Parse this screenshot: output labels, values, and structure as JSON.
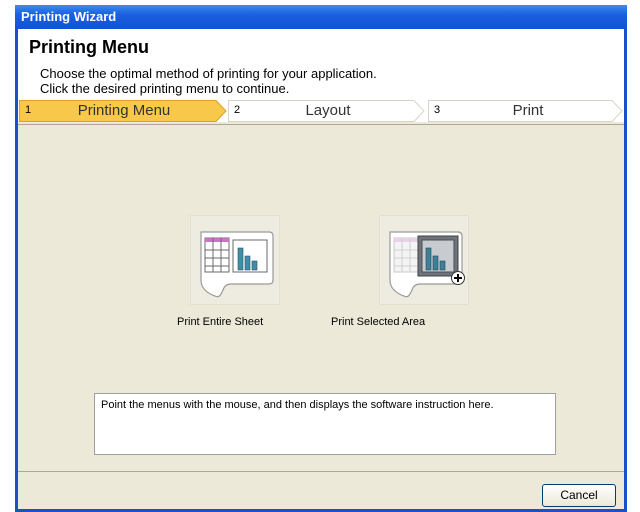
{
  "window": {
    "title": "Printing Wizard"
  },
  "header": {
    "title": "Printing Menu",
    "line1": "Choose the optimal method of printing for your application.",
    "line2": "Click the desired printing menu to continue."
  },
  "steps": [
    {
      "num": "1",
      "label": "Printing Menu"
    },
    {
      "num": "2",
      "label": "Layout"
    },
    {
      "num": "3",
      "label": "Print"
    }
  ],
  "menus": [
    {
      "label": "Print Entire Sheet",
      "icon": "entire-sheet-icon"
    },
    {
      "label": "Print Selected Area",
      "icon": "selected-area-icon"
    }
  ],
  "instruction": "Point the menus with the mouse, and then displays the software instruction here.",
  "footer": {
    "cancel_label": "Cancel"
  },
  "colors": {
    "title_bar": "#1b5fe0",
    "active_step": "#f7c84a",
    "panel": "#ece9d8"
  }
}
